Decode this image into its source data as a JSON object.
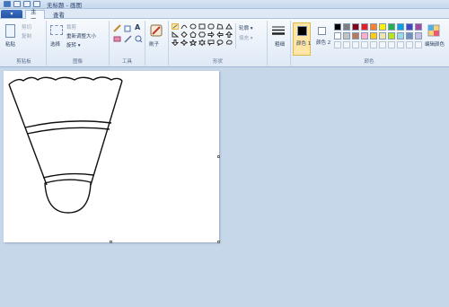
{
  "titlebar": {
    "title": "无标题 - 画图"
  },
  "tabs": {
    "app_menu_arrow": "▾",
    "home": "主页",
    "view": "查看"
  },
  "clipboard": {
    "paste": "粘贴",
    "cut": "剪切",
    "copy": "复制",
    "label": "剪贴板"
  },
  "image": {
    "select": "选择",
    "crop": "裁剪",
    "resize": "重新调整大小",
    "rotate": "旋转 ▾",
    "label": "图像"
  },
  "tools": {
    "label": "工具",
    "text_tool": "A"
  },
  "brushes": {
    "label": "刷子"
  },
  "shapes": {
    "outline": "轮廓 ▾",
    "fill": "填充 ▾",
    "label": "形状"
  },
  "size": {
    "label": "粗细"
  },
  "colors": {
    "color1_label": "颜色 1",
    "color2_label": "颜色 2",
    "edit_colors": "编辑颜色",
    "label": "颜色",
    "color1": "#000000",
    "color2": "#ffffff",
    "palette_row1": [
      "#000000",
      "#7f7f7f",
      "#880015",
      "#ed1c24",
      "#ff7f27",
      "#fff200",
      "#22b14c",
      "#00a2e8",
      "#3f48cc",
      "#a349a4"
    ],
    "palette_row2": [
      "#ffffff",
      "#c3c3c3",
      "#b97a57",
      "#ffaec9",
      "#ffc90e",
      "#efe4b0",
      "#b5e61d",
      "#99d9ea",
      "#7092be",
      "#c8bfe7"
    ]
  }
}
